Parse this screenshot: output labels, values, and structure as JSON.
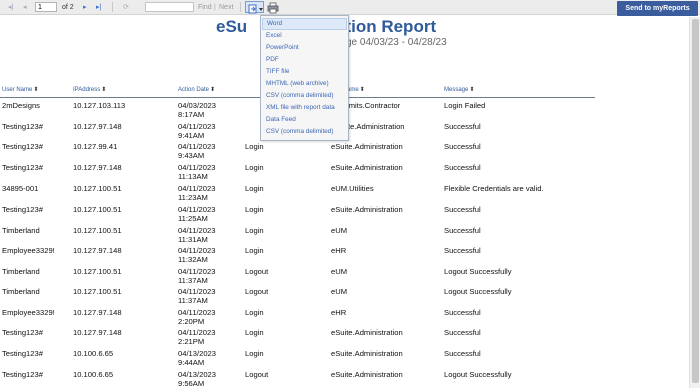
{
  "toolbar": {
    "first_icon": "◂|",
    "prev_icon": "◂",
    "page_value": "1",
    "of_pages": "of 2",
    "next_icon": "▸",
    "last_icon": "▸|",
    "refresh_icon": "⟳",
    "find_label": "Find",
    "divider": "|",
    "next_label": "Next",
    "send_label": "Send to myReports"
  },
  "report": {
    "title_a": "eSu",
    "title_b": "ation Report",
    "subtitle_a": "ge 04/03/23 - 04/28/23"
  },
  "columns": {
    "user": "User Name",
    "ip": "IPAddress",
    "date": "Action Date",
    "app": "ame",
    "msg": "Message"
  },
  "export_menu": [
    "Word",
    "Excel",
    "PowerPoint",
    "PDF",
    "TIFF file",
    "MHTML (web archive)",
    "CSV (comma delimited)",
    "XML file with report data",
    "Data Feed",
    "CSV (comma delimited)"
  ],
  "rows": [
    {
      "user": "2mDesigns",
      "ip": "10.127.103.113",
      "date": "04/03/2023",
      "time": "8:17AM",
      "action": "",
      "app": "s.Permits.Contractor",
      "msg": "Login Failed"
    },
    {
      "user": "Testing123#",
      "ip": "10.127.97.148",
      "date": "04/11/2023",
      "time": "9:41AM",
      "action": "",
      "app": "Suite.Administration",
      "msg": "Successful"
    },
    {
      "user": "Testing123#",
      "ip": "10.127.99.41",
      "date": "04/11/2023",
      "time": "9:43AM",
      "action": "Login",
      "app": "eSuite.Administration",
      "msg": "Successful"
    },
    {
      "user": "Testing123#",
      "ip": "10.127.97.148",
      "date": "04/11/2023",
      "time": "11:13AM",
      "action": "Login",
      "app": "eSuite.Administration",
      "msg": "Successful"
    },
    {
      "user": "34895-001",
      "ip": "10.127.100.51",
      "date": "04/11/2023",
      "time": "11:23AM",
      "action": "Login",
      "app": "eUM.Utilities",
      "msg": "Flexible Credentials are valid."
    },
    {
      "user": "Testing123#",
      "ip": "10.127.100.51",
      "date": "04/11/2023",
      "time": "11:25AM",
      "action": "Login",
      "app": "eSuite.Administration",
      "msg": "Successful"
    },
    {
      "user": "Timberland",
      "ip": "10.127.100.51",
      "date": "04/11/2023",
      "time": "11:31AM",
      "action": "Login",
      "app": "eUM",
      "msg": "Successful"
    },
    {
      "user": "Employee3329!",
      "ip": "10.127.97.148",
      "date": "04/11/2023",
      "time": "11:32AM",
      "action": "Login",
      "app": "eHR",
      "msg": "Successful"
    },
    {
      "user": "Timberland",
      "ip": "10.127.100.51",
      "date": "04/11/2023",
      "time": "11:37AM",
      "action": "Logout",
      "app": "eUM",
      "msg": "Logout Successfully"
    },
    {
      "user": "Timberland",
      "ip": "10.127.100.51",
      "date": "04/11/2023",
      "time": "11:37AM",
      "action": "Logout",
      "app": "eUM",
      "msg": "Logout Successfully"
    },
    {
      "user": "Employee3329!",
      "ip": "10.127.97.148",
      "date": "04/11/2023",
      "time": "2:20PM",
      "action": "Login",
      "app": "eHR",
      "msg": "Successful"
    },
    {
      "user": "Testing123#",
      "ip": "10.127.97.148",
      "date": "04/11/2023",
      "time": "2:21PM",
      "action": "Login",
      "app": "eSuite.Administration",
      "msg": "Successful"
    },
    {
      "user": "Testing123#",
      "ip": "10.100.6.65",
      "date": "04/13/2023",
      "time": "9:44AM",
      "action": "Login",
      "app": "eSuite.Administration",
      "msg": "Successful"
    },
    {
      "user": "Testing123#",
      "ip": "10.100.6.65",
      "date": "04/13/2023",
      "time": "9:56AM",
      "action": "Logout",
      "app": "eSuite.Administration",
      "msg": "Logout Successfully"
    }
  ],
  "colors": {
    "accent": "#2f5a9b",
    "link": "#3b66b3",
    "send_button": "#3b5d9e"
  }
}
